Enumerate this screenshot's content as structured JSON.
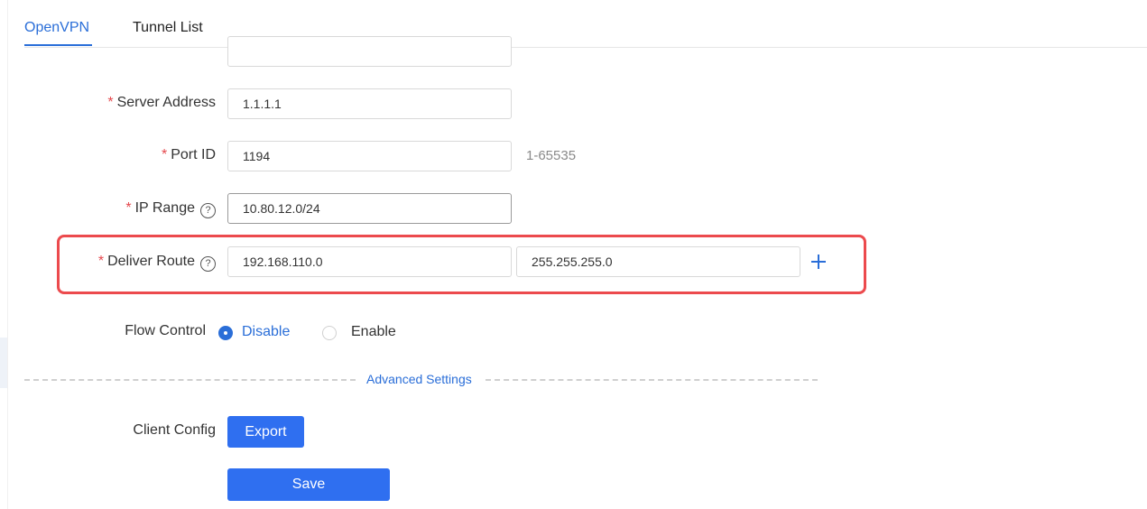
{
  "tabs": [
    {
      "label": "OpenVPN",
      "active": true
    },
    {
      "label": "Tunnel List",
      "active": false
    }
  ],
  "form": {
    "required_mark": "*",
    "server_address": {
      "label": "Server Address",
      "value": "1.1.1.1"
    },
    "port_id": {
      "label": "Port ID",
      "value": "1194",
      "hint": "1-65535"
    },
    "ip_range": {
      "label": "IP Range",
      "value": "10.80.12.0/24",
      "help_icon": "question-circle-icon"
    },
    "deliver_route": {
      "label": "Deliver Route",
      "ip": "192.168.110.0",
      "mask": "255.255.255.0",
      "help_icon": "question-circle-icon",
      "add_icon": "plus-icon"
    },
    "flow_control": {
      "label": "Flow Control",
      "options": [
        {
          "label": "Disable",
          "selected": true
        },
        {
          "label": "Enable",
          "selected": false
        }
      ]
    },
    "advanced_settings": "Advanced Settings",
    "client_config": {
      "label": "Client Config",
      "button": "Export"
    },
    "save_button": "Save"
  },
  "colors": {
    "accent": "#2a6ed8",
    "button": "#2f6ff0",
    "required": "#e5484d",
    "highlight_border": "#ec4a4d"
  }
}
